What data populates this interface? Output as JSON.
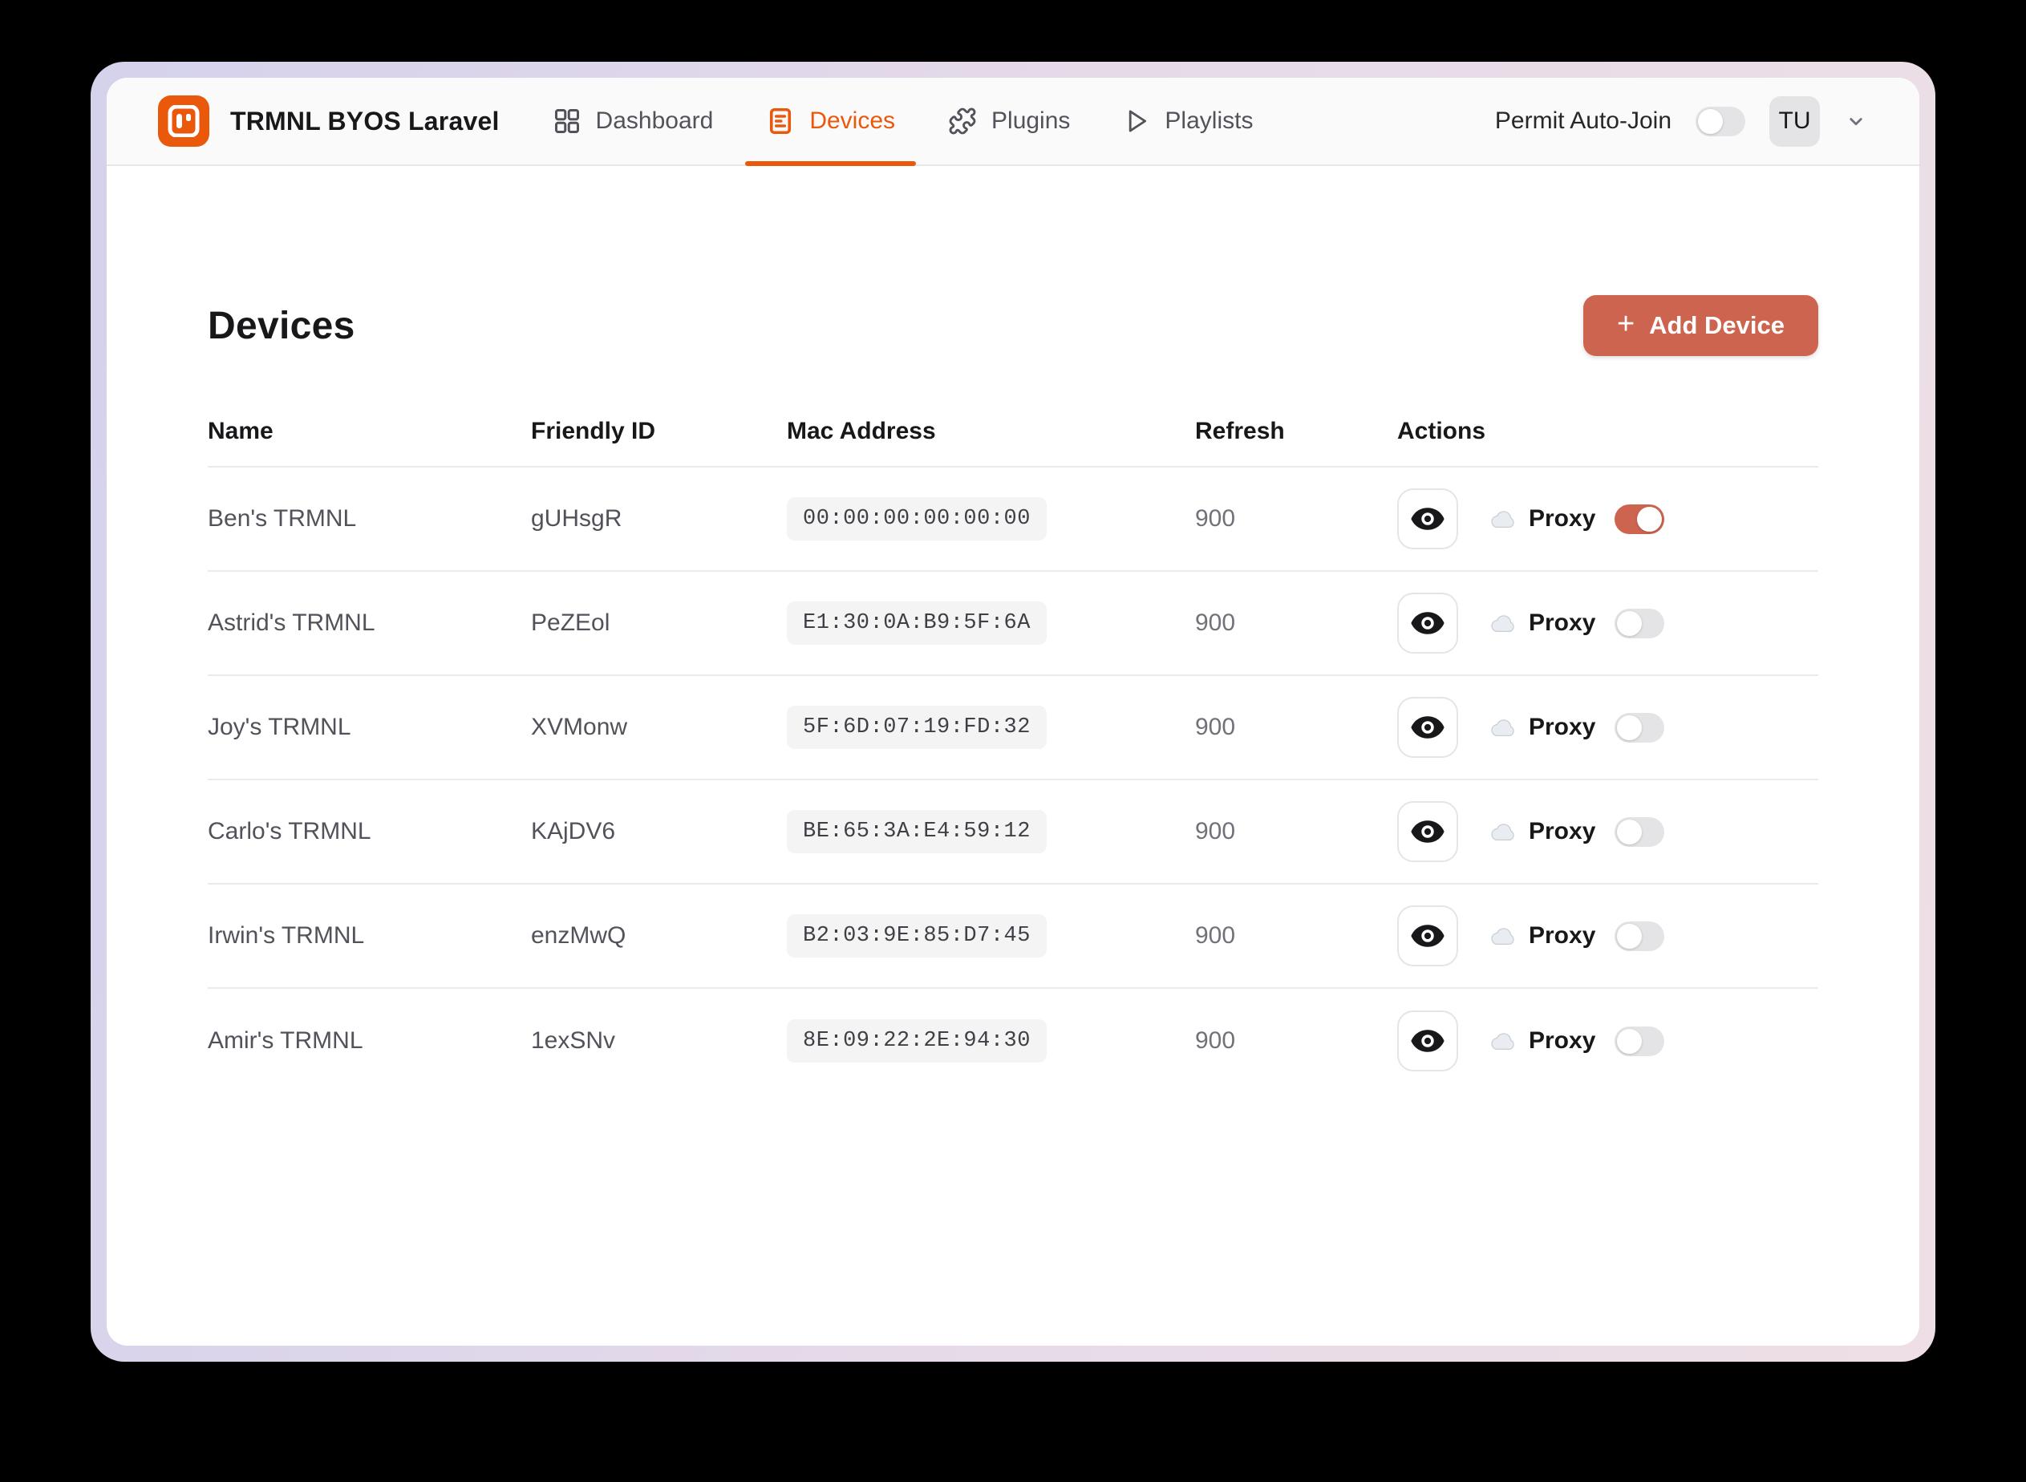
{
  "colors": {
    "accent": "#ea580c",
    "accent-soft": "#cd6450",
    "ink": "#18181b",
    "ink-2": "#27272a",
    "muted-ink": "#52525b",
    "card": "#ffffff",
    "header-bg": "#fafafa",
    "header-border": "#e7e7e9",
    "divider": "#ebebed",
    "pill-bg": "#f4f4f5",
    "toggle-off": "#e4e4e7",
    "avatar-bg": "#e4e4e7",
    "btn-border": "#e5e5e8",
    "frame1": "#d5d2ec",
    "frame2": "#e7dbe8",
    "frame3": "#eedfe6"
  },
  "appbar": {
    "brand_title": "TRMNL BYOS Laravel",
    "nav": {
      "items": [
        {
          "label": "Dashboard",
          "active": false
        },
        {
          "label": "Devices",
          "active": true
        },
        {
          "label": "Plugins",
          "active": false
        },
        {
          "label": "Playlists",
          "active": false
        }
      ]
    },
    "permit_label": "Permit Auto-Join",
    "permit_on": false,
    "avatar_initials": "TU"
  },
  "page": {
    "title": "Devices",
    "add_button_label": "Add Device",
    "add_button_plus": "+"
  },
  "table": {
    "columns": [
      "Name",
      "Friendly ID",
      "Mac Address",
      "Refresh",
      "Actions"
    ],
    "proxy_label": "Proxy",
    "rows": [
      {
        "name": "Ben's TRMNL",
        "friendly_id": "gUHsgR",
        "mac": "00:00:00:00:00:00",
        "refresh": "900",
        "proxy_on": true
      },
      {
        "name": "Astrid's TRMNL",
        "friendly_id": "PeZEol",
        "mac": "E1:30:0A:B9:5F:6A",
        "refresh": "900",
        "proxy_on": false
      },
      {
        "name": "Joy's TRMNL",
        "friendly_id": "XVMonw",
        "mac": "5F:6D:07:19:FD:32",
        "refresh": "900",
        "proxy_on": false
      },
      {
        "name": "Carlo's TRMNL",
        "friendly_id": "KAjDV6",
        "mac": "BE:65:3A:E4:59:12",
        "refresh": "900",
        "proxy_on": false
      },
      {
        "name": "Irwin's TRMNL",
        "friendly_id": "enzMwQ",
        "mac": "B2:03:9E:85:D7:45",
        "refresh": "900",
        "proxy_on": false
      },
      {
        "name": "Amir's TRMNL",
        "friendly_id": "1exSNv",
        "mac": "8E:09:22:2E:94:30",
        "refresh": "900",
        "proxy_on": false
      }
    ]
  }
}
